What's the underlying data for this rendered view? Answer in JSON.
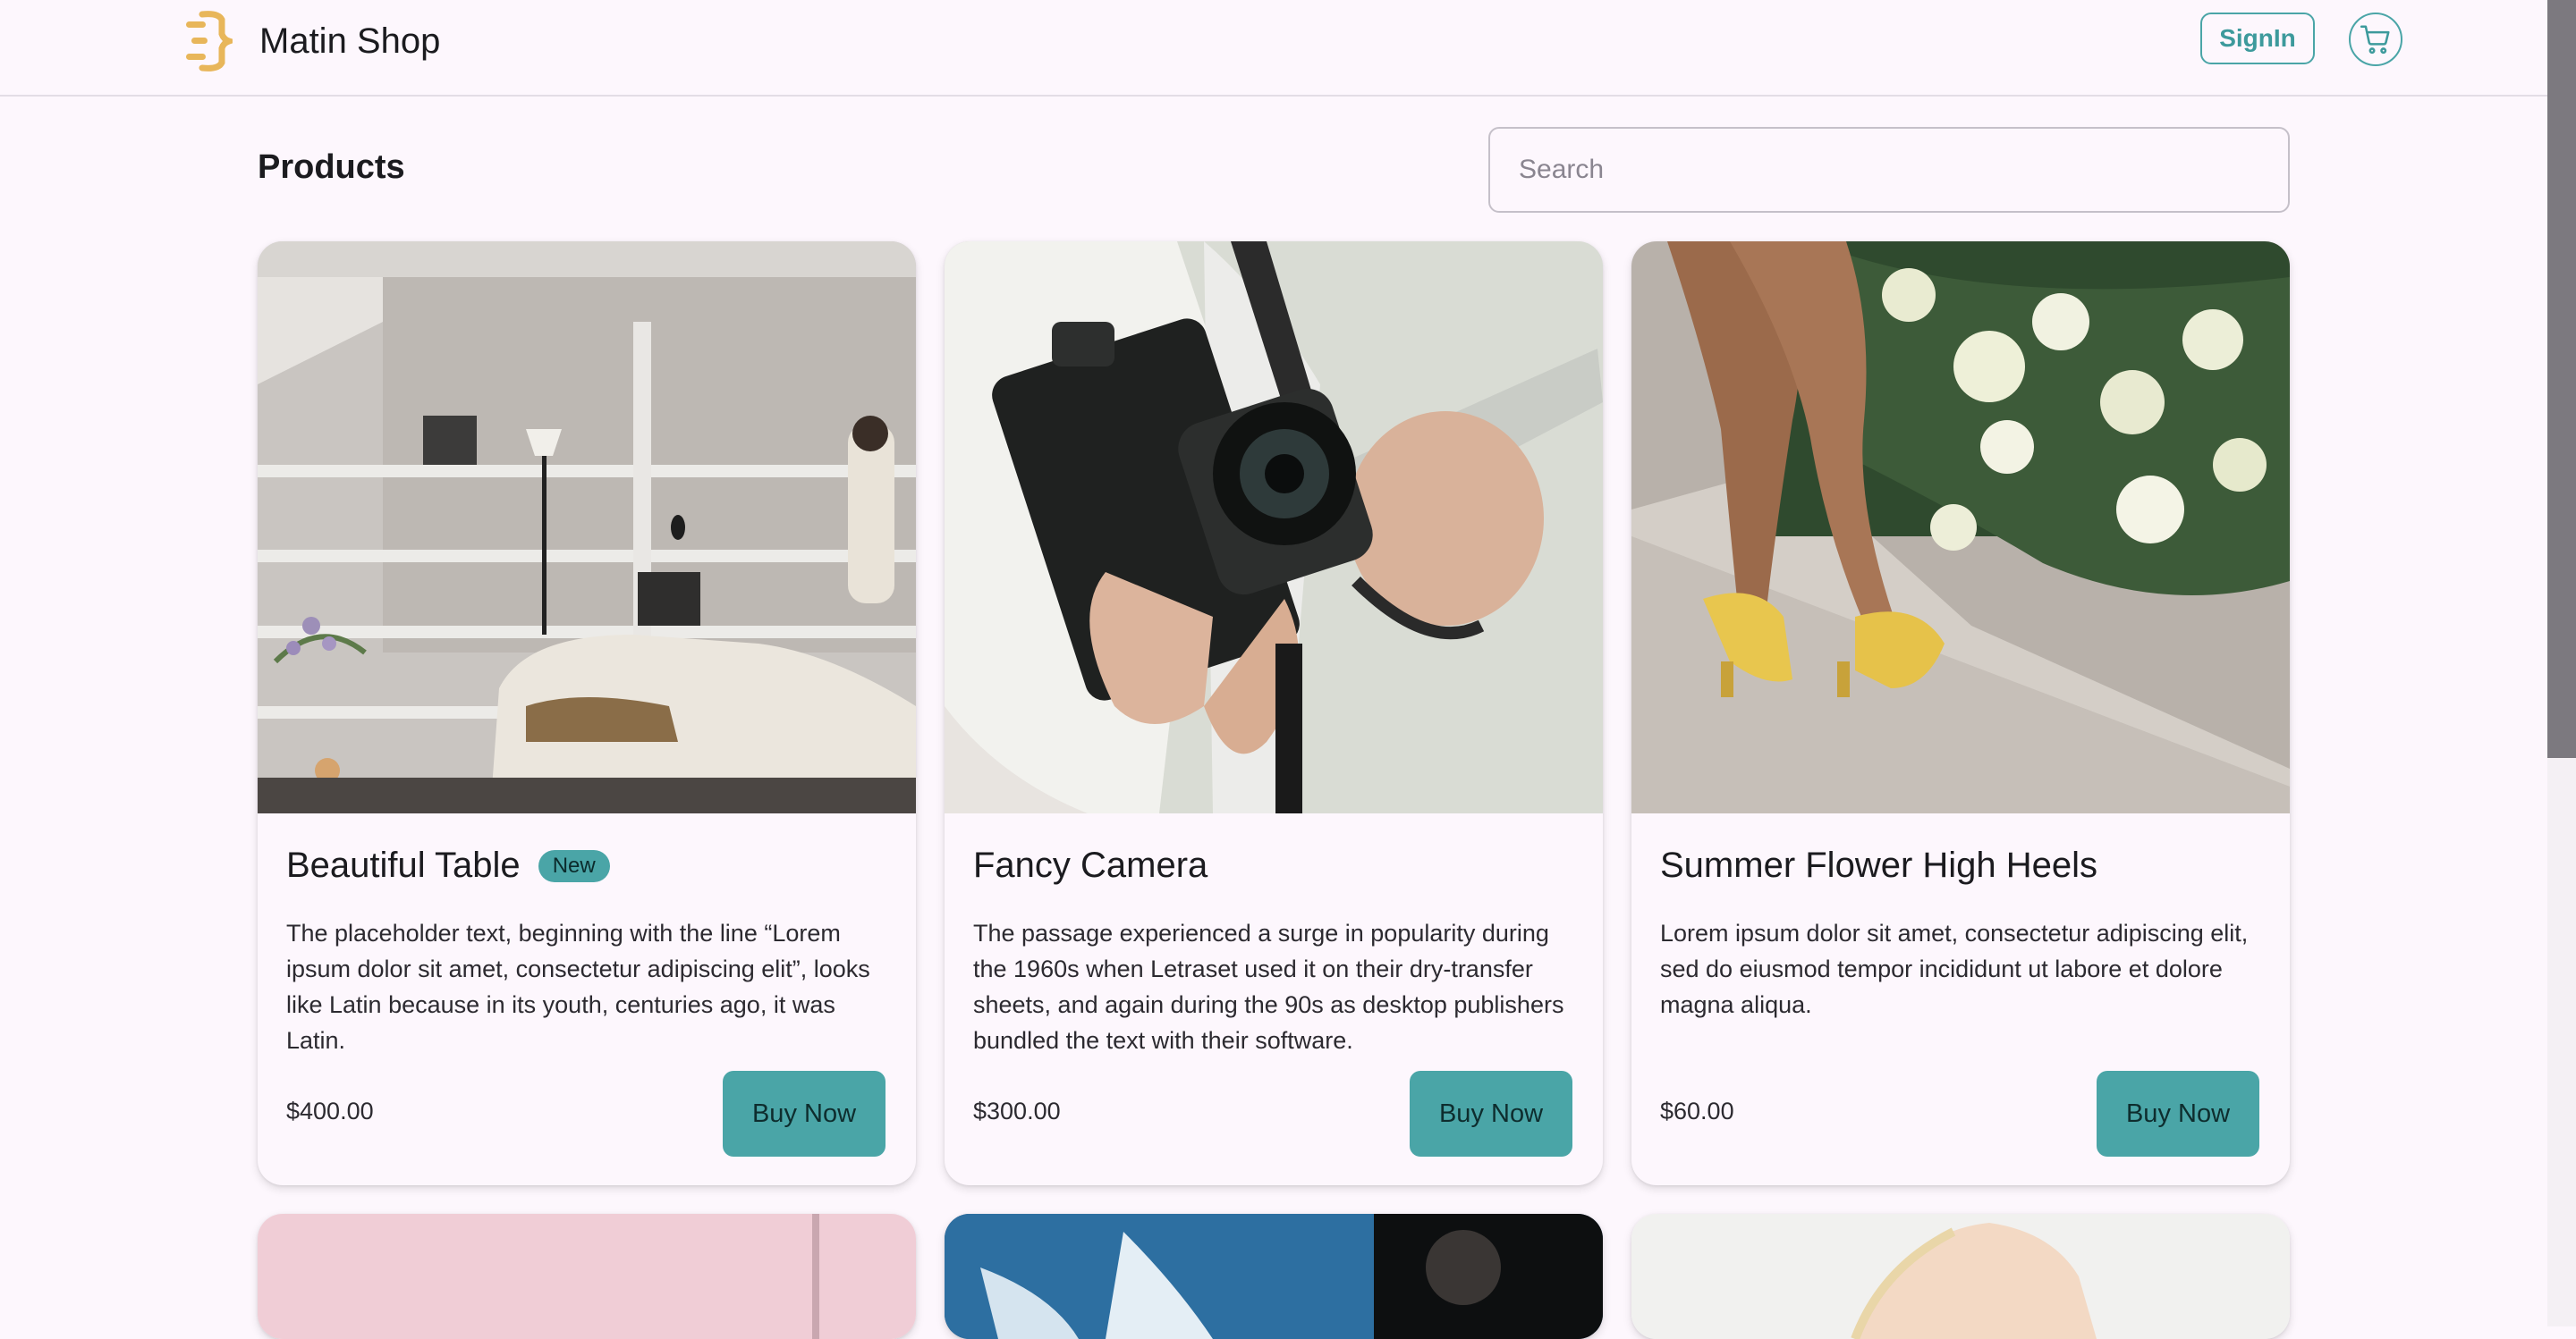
{
  "header": {
    "brand_name": "Matin Shop",
    "signin_label": "SignIn",
    "accent_color": "#4aa5a7",
    "logo_color": "#e8b65a"
  },
  "main": {
    "title": "Products",
    "search_placeholder": "Search"
  },
  "products": [
    {
      "title": "Beautiful Table",
      "badge": "New",
      "description": "The placeholder text, beginning with the line “Lorem ipsum dolor sit amet, consectetur adipiscing elit”, looks like Latin because in its youth, centuries ago, it was Latin.",
      "price": "$400.00",
      "button": "Buy Now",
      "image": "living room with shelves, lamp and a woman holding books"
    },
    {
      "title": "Fancy Camera",
      "badge": "",
      "description": "The passage experienced a surge in popularity during the 1960s when Letraset used it on their dry-transfer sheets, and again during the 90s as desktop publishers bundled the text with their software.",
      "price": "$300.00",
      "button": "Buy Now",
      "image": "hands holding a black film camera and a phone"
    },
    {
      "title": "Summer Flower High Heels",
      "badge": "",
      "description": "Lorem ipsum dolor sit amet, consectetur adipiscing elit, sed do eiusmod tempor incididunt ut labore et dolore magna aliqua.",
      "price": "$60.00",
      "button": "Buy Now",
      "image": "legs wearing yellow floral heels beside hydrangea bush"
    }
  ],
  "icons": {
    "brand": "brand-logo-icon",
    "cart": "cart-icon"
  }
}
